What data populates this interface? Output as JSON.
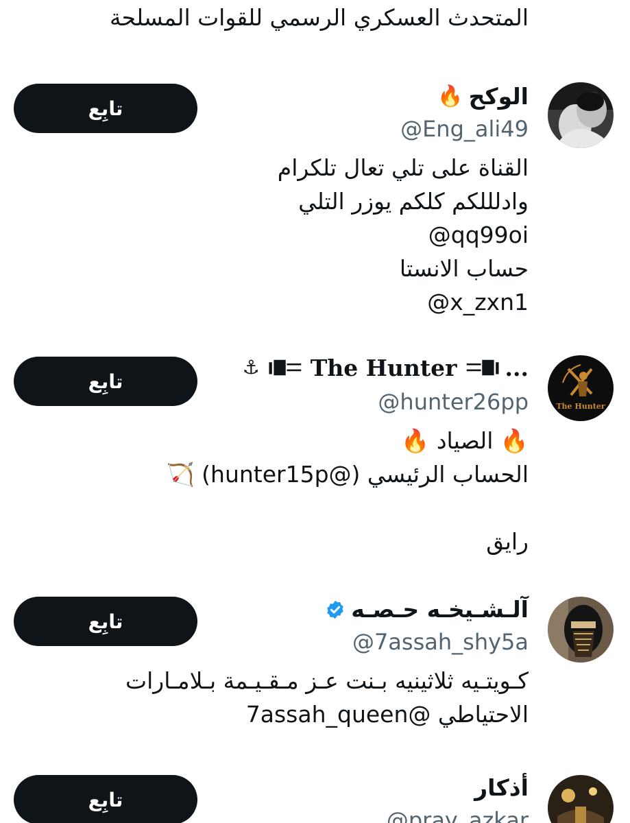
{
  "top_bio": "المتحدث العسكري الرسمي للقوات المسلحة",
  "follow_label": "تابِع",
  "users": [
    {
      "display_name": "الوكح",
      "name_emoji": "🔥",
      "handle": "@Eng_ali49",
      "bio_lines": [
        "القناة على تلي تعال تلكرام",
        "وادلللكم كلكم يوزر التلي",
        "@qq99oi",
        "حساب الانستا",
        "@x_zxn1"
      ]
    },
    {
      "display_name": "The Hunter",
      "name_anchor": "⚓",
      "name_ellipsis": "...",
      "handle": "@hunter26pp",
      "avatar_text": "The Hunter",
      "bio_lines": [
        "🔥 الصياد 🔥",
        "الحساب الرئيسي (@hunter15p) 🏹",
        "",
        "رايق"
      ]
    },
    {
      "display_name": "آلـشـيخـه حـصـه",
      "handle": "@7assah_shy5a",
      "verified": true,
      "bio_lines": [
        "كـويتـيه ثلاثينيه بـنت عـز مـقـيـمة بـلامـارات",
        "الاحتياطي @7assah_queen"
      ]
    },
    {
      "display_name": "أذكار",
      "handle": "@pray_azkar",
      "bio_lines": []
    }
  ],
  "colors": {
    "text": "#0f1419",
    "secondary": "#536471",
    "button_bg": "#0f1419",
    "button_text": "#ffffff",
    "verified_blue": "#1d9bf0"
  }
}
